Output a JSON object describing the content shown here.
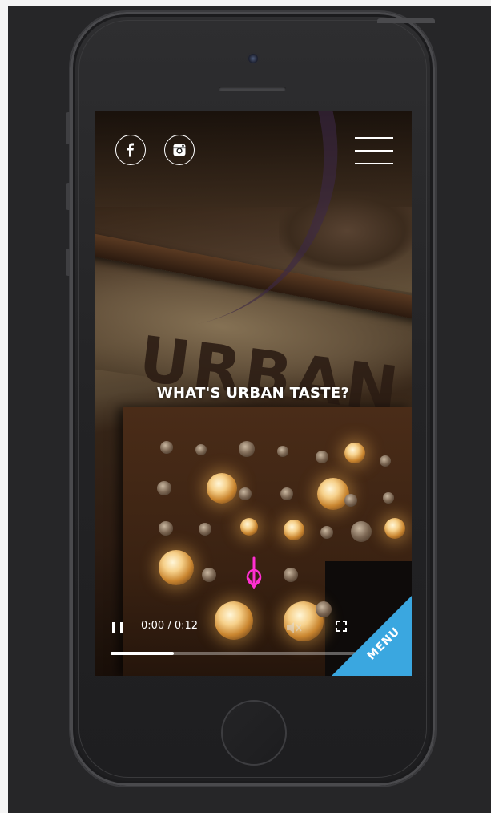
{
  "header": {
    "facebook_icon": "facebook-icon",
    "instagram_icon": "instagram-icon",
    "menu_icon": "hamburger-icon"
  },
  "hero": {
    "headline": "WHAT'S URBAN TASTE?"
  },
  "video": {
    "state": "playing",
    "time_display": "0:00 / 0:12",
    "progress_fraction": 0.24,
    "muted": true
  },
  "ribbon": {
    "label": "MENU",
    "color": "#3aa7e0"
  },
  "colors": {
    "page_background": "#262628",
    "phone_body": "#232325",
    "neon_accent": "#ff2fd0"
  }
}
